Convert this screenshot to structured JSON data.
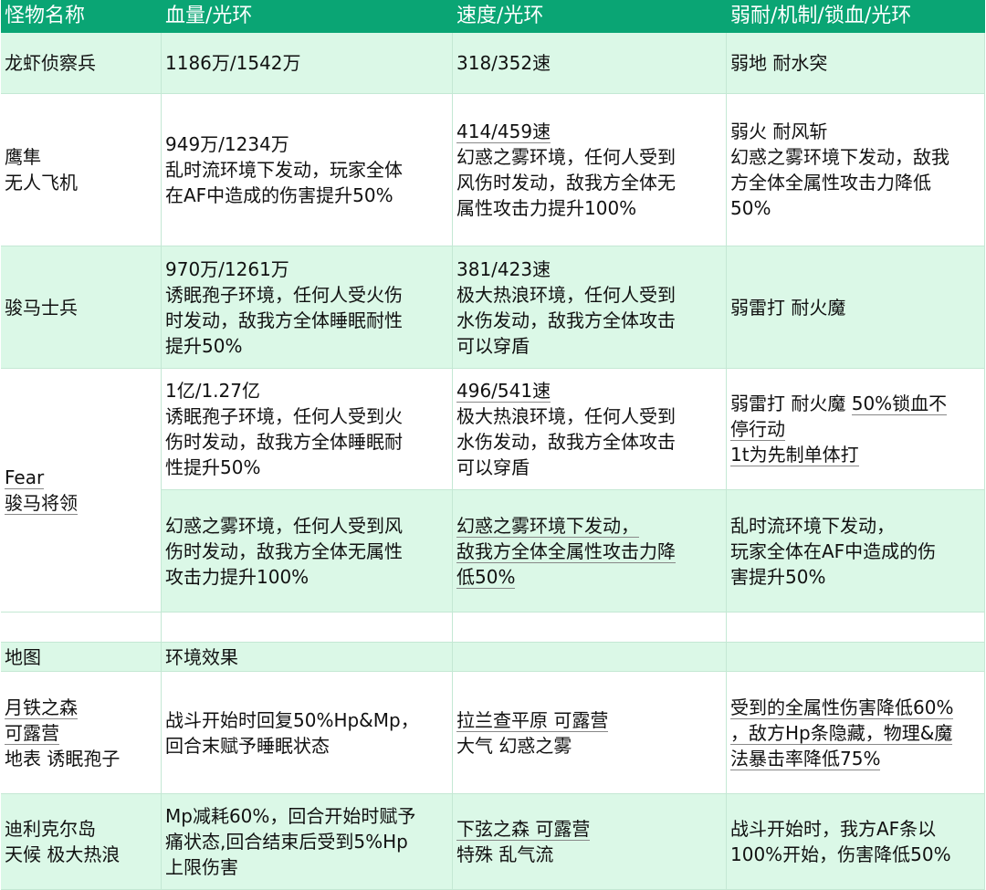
{
  "colors": {
    "header": "#0aa574",
    "band": "#dbf8e7",
    "border": "#c4e8d4"
  },
  "cells": [
    {
      "r": 1,
      "c": 1,
      "rs": 1,
      "bg": "h",
      "lines": [
        {
          "t": "怪物名称"
        }
      ]
    },
    {
      "r": 1,
      "c": 2,
      "rs": 1,
      "bg": "h",
      "lines": [
        {
          "t": "血量/光环"
        }
      ]
    },
    {
      "r": 1,
      "c": 3,
      "rs": 1,
      "bg": "h",
      "lines": [
        {
          "t": "速度/光环"
        }
      ]
    },
    {
      "r": 1,
      "c": 4,
      "rs": 1,
      "bg": "h",
      "lines": [
        {
          "t": "弱耐/机制/锁血/光环"
        }
      ]
    },
    {
      "r": 2,
      "c": 1,
      "rs": 1,
      "bg": "g",
      "lines": [
        {
          "t": "龙虾侦察兵"
        }
      ]
    },
    {
      "r": 2,
      "c": 2,
      "rs": 1,
      "bg": "g",
      "lines": [
        {
          "t": "1186万/1542万"
        }
      ]
    },
    {
      "r": 2,
      "c": 3,
      "rs": 1,
      "bg": "g",
      "lines": [
        {
          "t": "318/352速"
        }
      ]
    },
    {
      "r": 2,
      "c": 4,
      "rs": 1,
      "bg": "g",
      "lines": [
        {
          "t": "弱地 耐水突"
        }
      ]
    },
    {
      "r": 3,
      "c": 1,
      "rs": 1,
      "bg": "w",
      "lines": [
        {
          "t": "鹰隼"
        },
        {
          "t": "无人飞机"
        }
      ]
    },
    {
      "r": 3,
      "c": 2,
      "rs": 1,
      "bg": "w",
      "lines": [
        {
          "t": "949万/1234万"
        },
        {
          "t": "乱时流环境下发动，玩家全体"
        },
        {
          "t": "在AF中造成的伤害提升50%"
        }
      ]
    },
    {
      "r": 3,
      "c": 3,
      "rs": 1,
      "bg": "w",
      "lines": [
        {
          "t": "414/459速",
          "u": true
        },
        {
          "t": "幻惑之雾环境，任何人受到"
        },
        {
          "t": "风伤时发动，敌我方全体无"
        },
        {
          "t": "属性攻击力提升100%"
        }
      ]
    },
    {
      "r": 3,
      "c": 4,
      "rs": 1,
      "bg": "w",
      "lines": [
        {
          "t": "弱火 耐风斩"
        },
        {
          "t": "幻惑之雾环境下发动，敌我"
        },
        {
          "t": "方全体全属性攻击力降低"
        },
        {
          "t": "50%"
        }
      ]
    },
    {
      "r": 4,
      "c": 1,
      "rs": 1,
      "bg": "g",
      "lines": [
        {
          "t": "骏马士兵"
        }
      ]
    },
    {
      "r": 4,
      "c": 2,
      "rs": 1,
      "bg": "g",
      "lines": [
        {
          "t": "970万/1261万"
        },
        {
          "t": "诱眠孢子环境，任何人受火伤"
        },
        {
          "t": "时发动，敌我方全体睡眠耐性"
        },
        {
          "t": "提升50%"
        }
      ]
    },
    {
      "r": 4,
      "c": 3,
      "rs": 1,
      "bg": "g",
      "lines": [
        {
          "t": "381/423速"
        },
        {
          "t": "极大热浪环境，任何人受到"
        },
        {
          "t": "水伤发动，敌我方全体攻击"
        },
        {
          "t": "可以穿盾"
        }
      ]
    },
    {
      "r": 4,
      "c": 4,
      "rs": 1,
      "bg": "g",
      "lines": [
        {
          "t": "弱雷打 耐火魔"
        }
      ]
    },
    {
      "r": 5,
      "c": 1,
      "rs": 2,
      "bg": "w",
      "lines": [
        {
          "t": "Fear",
          "u": true
        },
        {
          "t": "骏马将领",
          "u": true
        }
      ]
    },
    {
      "r": 5,
      "c": 2,
      "rs": 1,
      "bg": "w",
      "lines": [
        {
          "t": "1亿/1.27亿"
        },
        {
          "t": "诱眠孢子环境，任何人受到火"
        },
        {
          "t": "伤时发动，敌我方全体睡眠耐"
        },
        {
          "t": "性提升50%"
        }
      ]
    },
    {
      "r": 5,
      "c": 3,
      "rs": 1,
      "bg": "w",
      "lines": [
        {
          "t": "496/541速",
          "u": true
        },
        {
          "t": "极大热浪环境，任何人受到"
        },
        {
          "t": "水伤发动，敌我方全体攻击"
        },
        {
          "t": "可以穿盾"
        }
      ]
    },
    {
      "r": 5,
      "c": 4,
      "rs": 1,
      "bg": "w",
      "lines": [
        {
          "t": "弱雷打 耐火魔 ",
          "t2": "50%锁血不"
        },
        {
          "t": "停行动",
          "u": true
        },
        {
          "t": "1t为先制单体打",
          "u": true
        }
      ]
    },
    {
      "r": 6,
      "c": 2,
      "rs": 1,
      "bg": "g",
      "lines": [
        {
          "t": "幻惑之雾环境，任何人受到风"
        },
        {
          "t": "伤时发动，敌我方全体无属性"
        },
        {
          "t": "攻击力提升100%"
        }
      ]
    },
    {
      "r": 6,
      "c": 3,
      "rs": 1,
      "bg": "g",
      "lines": [
        {
          "t": "幻惑之雾环境下发动，",
          "u": true
        },
        {
          "t": "敌我方全体全属性攻击力降",
          "u": true
        },
        {
          "t": "低50%",
          "u": true
        }
      ]
    },
    {
      "r": 6,
      "c": 4,
      "rs": 1,
      "bg": "g",
      "lines": [
        {
          "t": "乱时流环境下发动，"
        },
        {
          "t": "玩家全体在AF中造成的伤"
        },
        {
          "t": "害提升50%"
        }
      ]
    },
    {
      "r": 7,
      "c": 1,
      "rs": 1,
      "bg": "w",
      "lines": []
    },
    {
      "r": 7,
      "c": 2,
      "rs": 1,
      "bg": "w",
      "lines": []
    },
    {
      "r": 7,
      "c": 3,
      "rs": 1,
      "bg": "w",
      "lines": []
    },
    {
      "r": 7,
      "c": 4,
      "rs": 1,
      "bg": "w",
      "lines": []
    },
    {
      "r": 8,
      "c": 1,
      "rs": 1,
      "bg": "g",
      "lines": [
        {
          "t": "地图"
        }
      ]
    },
    {
      "r": 8,
      "c": 2,
      "rs": 1,
      "bg": "g",
      "lines": [
        {
          "t": "环境效果"
        }
      ]
    },
    {
      "r": 8,
      "c": 3,
      "rs": 1,
      "bg": "g",
      "lines": []
    },
    {
      "r": 8,
      "c": 4,
      "rs": 1,
      "bg": "g",
      "lines": []
    },
    {
      "r": 9,
      "c": 1,
      "rs": 1,
      "bg": "w",
      "lines": [
        {
          "t": "月铁之森 ",
          "u": true
        },
        {
          "t": "可露营",
          "u": true
        },
        {
          "t": "地表 诱眠孢子"
        }
      ]
    },
    {
      "r": 9,
      "c": 2,
      "rs": 1,
      "bg": "w",
      "lines": [
        {
          "t": "战斗开始时回复50%Hp&Mp，"
        },
        {
          "t": "回合末赋予睡眠状态"
        }
      ]
    },
    {
      "r": 9,
      "c": 3,
      "rs": 1,
      "bg": "w",
      "lines": [
        {
          "t": "拉兰查平原 可露营",
          "u": true
        },
        {
          "t": "大气 幻惑之雾"
        }
      ]
    },
    {
      "r": 9,
      "c": 4,
      "rs": 1,
      "bg": "w",
      "lines": [
        {
          "t": "受到的全属性伤害降低60%",
          "u": true
        },
        {
          "t": "，敌方Hp条隐藏，物理&魔",
          "u": true
        },
        {
          "t": "法暴击率降低75%",
          "u": true
        }
      ]
    },
    {
      "r": 10,
      "c": 1,
      "rs": 1,
      "bg": "g",
      "lines": [
        {
          "t": "迪利克尔岛"
        },
        {
          "t": "天候 极大热浪"
        }
      ]
    },
    {
      "r": 10,
      "c": 2,
      "rs": 1,
      "bg": "g",
      "lines": [
        {
          "t": "Mp减耗60%，回合开始时赋予"
        },
        {
          "t": "痛状态,回合结束后受到5%Hp"
        },
        {
          "t": "上限伤害"
        }
      ]
    },
    {
      "r": 10,
      "c": 3,
      "rs": 1,
      "bg": "g",
      "lines": [
        {
          "t": "下弦之森 可露营",
          "u": true
        },
        {
          "t": "特殊 乱气流"
        }
      ]
    },
    {
      "r": 10,
      "c": 4,
      "rs": 1,
      "bg": "g",
      "lines": [
        {
          "t": "战斗开始时，我方AF条以"
        },
        {
          "t": "100%开始，伤害降低50%"
        }
      ]
    }
  ]
}
